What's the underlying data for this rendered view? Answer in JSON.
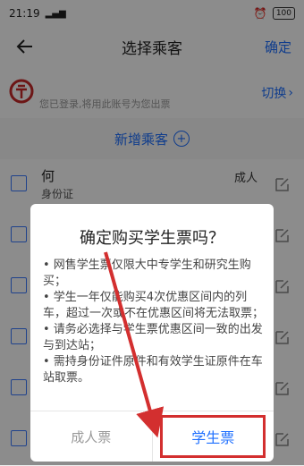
{
  "status_bar": {
    "time": "21:19",
    "signal": "ᯤ ",
    "battery": "100"
  },
  "nav": {
    "title": "选择乘客",
    "confirm": "确定"
  },
  "login": {
    "text": "您已登录,将用此账号为您出票",
    "switch": "切换"
  },
  "add_passenger": {
    "label": "新增乘客"
  },
  "passengers": [
    {
      "name": "何",
      "id_type": "身份证",
      "type": "成人"
    }
  ],
  "dialog": {
    "title": "确定购买学生票吗？",
    "bullets": [
      "• 网售学生票仅限大中专学生和研究生购买；",
      "• 学生一年仅能购买4次优惠区间内的列车，超过一次或不在优惠区间将无法取票；",
      "• 请务必选择与学生票优惠区间一致的出发与到达站；",
      "• 需持身份证件原件和有效学生证原件在车站取票。"
    ],
    "adult_button": "成人票",
    "student_button": "学生票"
  },
  "colors": {
    "accent": "#1e6fff",
    "highlight": "#d32f2f"
  }
}
